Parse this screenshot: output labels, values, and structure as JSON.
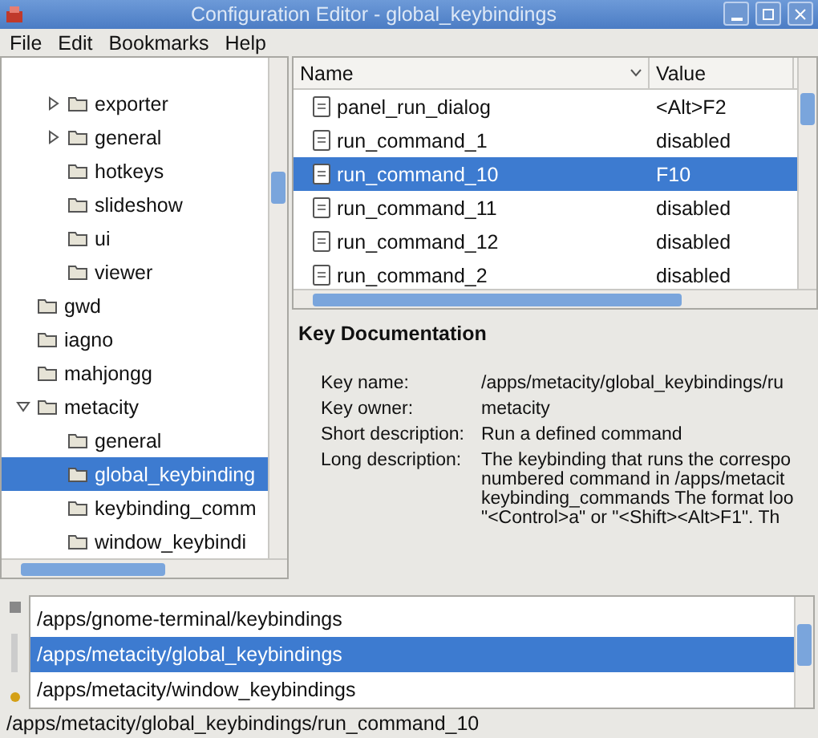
{
  "window": {
    "title": "Configuration Editor - global_keybindings"
  },
  "menu": [
    "File",
    "Edit",
    "Bookmarks",
    "Help"
  ],
  "tree": [
    {
      "children": [
        {
          "label": "exporter",
          "expanded": false,
          "selected": false
        },
        {
          "label": "general",
          "expanded": false,
          "selected": false
        },
        {
          "label": "hotkeys",
          "selected": false
        },
        {
          "label": "slideshow",
          "selected": false
        },
        {
          "label": "ui",
          "selected": false
        },
        {
          "label": "viewer",
          "selected": false
        }
      ]
    },
    {
      "label": "gwd",
      "selected": false
    },
    {
      "label": "iagno",
      "selected": false
    },
    {
      "label": "mahjongg",
      "selected": false
    },
    {
      "label": "metacity",
      "expanded": true,
      "selected": false,
      "children": [
        {
          "label": "general",
          "selected": false
        },
        {
          "label": "global_keybinding",
          "selected": true
        },
        {
          "label": "keybinding_comm",
          "selected": false
        },
        {
          "label": "window_keybindi",
          "selected": false
        }
      ]
    }
  ],
  "keys": {
    "columns": [
      "Name",
      "Value"
    ],
    "rows": [
      {
        "name": "panel_run_dialog",
        "value": "<Alt>F2",
        "selected": false
      },
      {
        "name": "run_command_1",
        "value": "disabled",
        "selected": false
      },
      {
        "name": "run_command_10",
        "value": "F10",
        "selected": true
      },
      {
        "name": "run_command_11",
        "value": "disabled",
        "selected": false
      },
      {
        "name": "run_command_12",
        "value": "disabled",
        "selected": false
      },
      {
        "name": "run_command_2",
        "value": "disabled",
        "selected": false
      }
    ]
  },
  "documentation": {
    "title": "Key Documentation",
    "fields": [
      {
        "label": "Key name:",
        "lines": [
          "/apps/metacity/global_keybindings/ru"
        ]
      },
      {
        "label": "Key owner:",
        "lines": [
          "metacity"
        ]
      },
      {
        "label": "Short description:",
        "lines": [
          "Run a defined command"
        ]
      },
      {
        "label": "Long description:",
        "lines": [
          "The keybinding that runs the correspo",
          "numbered command in /apps/metacit",
          "keybinding_commands The format loo",
          "\"<Control>a\" or \"<Shift><Alt>F1\". Th"
        ]
      }
    ]
  },
  "bookmarks": [
    {
      "path": "/apps/gnome-terminal/keybindings",
      "selected": false
    },
    {
      "path": "/apps/metacity/global_keybindings",
      "selected": true
    },
    {
      "path": "/apps/metacity/window_keybindings",
      "selected": false
    }
  ],
  "status_bar": "/apps/metacity/global_keybindings/run_command_10"
}
